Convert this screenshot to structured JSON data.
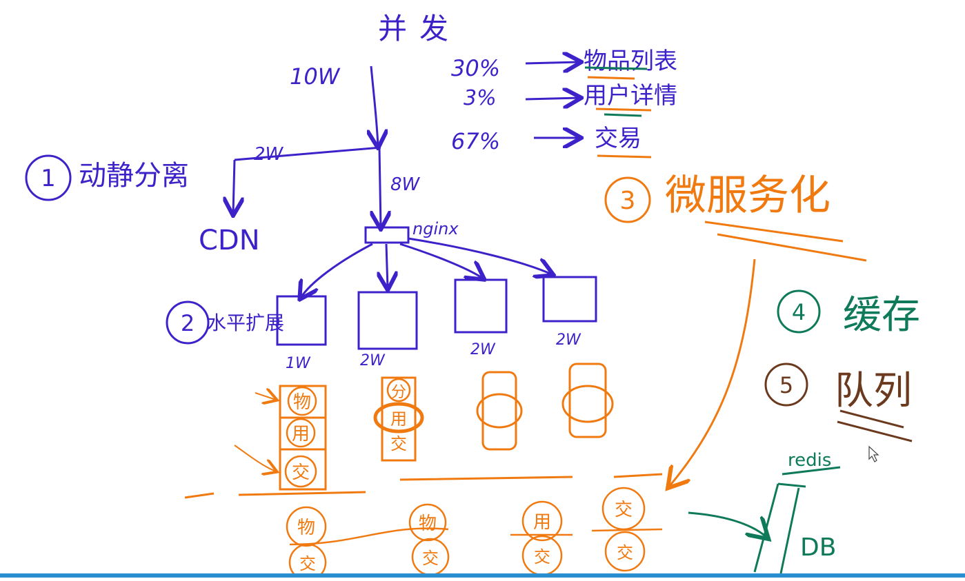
{
  "colors": {
    "purple": "#3c22c8",
    "orange": "#f07a10",
    "green": "#0e7a5a",
    "brown": "#6b3a1e",
    "accent_bar": "#2a8fd0"
  },
  "title": "并发",
  "traffic": {
    "total": "10W",
    "to_cdn": "2W",
    "to_nginx": "8W",
    "cdn_label": "CDN",
    "nginx_label": "nginx",
    "breakdown": [
      {
        "percent": "30%",
        "target": "物品列表"
      },
      {
        "percent": "3%",
        "target": "用户详情"
      },
      {
        "percent": "67%",
        "target": "交易"
      }
    ]
  },
  "steps": [
    {
      "num": "1",
      "label": "动静分离"
    },
    {
      "num": "2",
      "label": "水平扩展"
    },
    {
      "num": "3",
      "label": "微服务化"
    },
    {
      "num": "4",
      "label": "缓存"
    },
    {
      "num": "5",
      "label": "队列"
    }
  ],
  "servers": [
    {
      "load": "1W",
      "modules": [
        "物",
        "用",
        "交"
      ]
    },
    {
      "load": "2W",
      "modules": [
        "分",
        "用",
        "交"
      ]
    },
    {
      "load": "2W",
      "modules": [
        ""
      ]
    },
    {
      "load": "2W",
      "modules": [
        ""
      ]
    }
  ],
  "services": [
    {
      "top": "物",
      "bottom": "交"
    },
    {
      "top": "物",
      "bottom": "交"
    },
    {
      "top": "用",
      "bottom": "交"
    },
    {
      "top": "交",
      "bottom": "交"
    }
  ],
  "cache_label": "redis",
  "db_label": "DB"
}
